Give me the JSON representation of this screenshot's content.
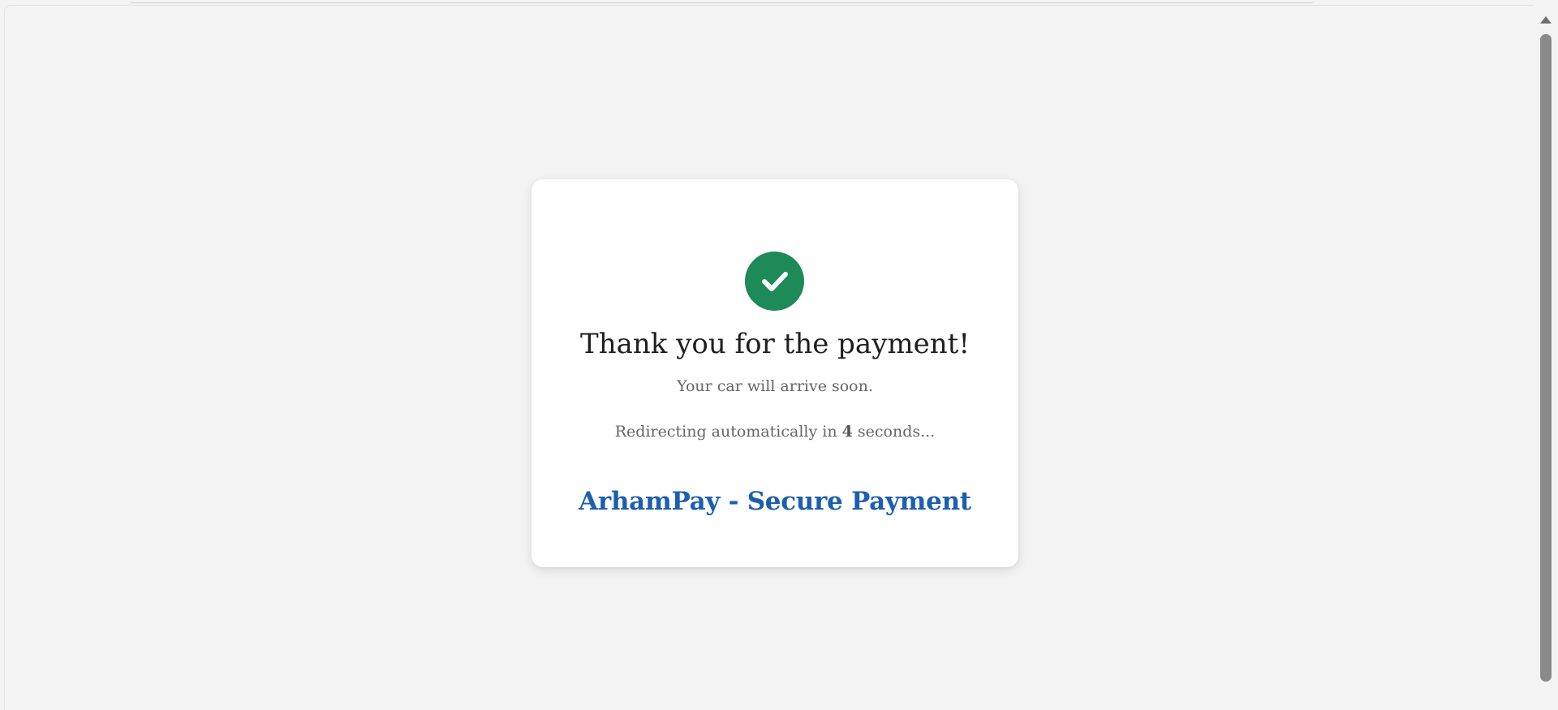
{
  "success": {
    "icon": "check-circle-icon",
    "color": "#1e8a57",
    "title": "Thank you for the payment!",
    "subtitle": "Your car will arrive soon.",
    "redirect_prefix": "Redirecting automatically in ",
    "redirect_seconds": "4",
    "redirect_suffix": " seconds..."
  },
  "brand": {
    "name": "ArhamPay - Secure Payment",
    "color": "#1c5fae"
  }
}
